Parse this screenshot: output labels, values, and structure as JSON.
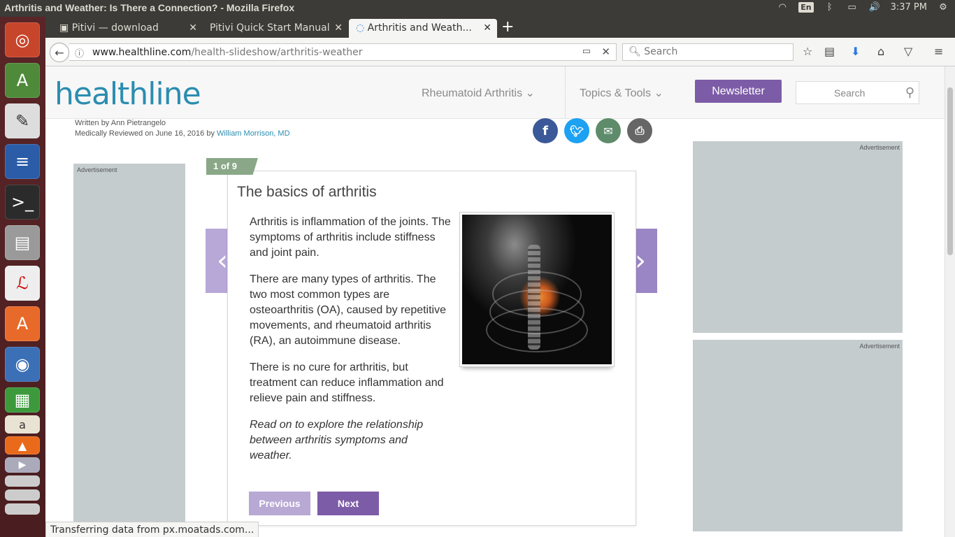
{
  "window": {
    "title": "Arthritis and Weather: Is There a Connection? - Mozilla Firefox"
  },
  "tray": {
    "lang": "En",
    "time": "3:37 PM"
  },
  "tabs": [
    {
      "label": "Pitivi — download"
    },
    {
      "label": "Pitivi Quick Start Manual"
    },
    {
      "label": "Arthritis and Weath..."
    }
  ],
  "nav": {
    "url_domain": "www.healthline.com",
    "url_path": "/health-slideshow/arthritis-weather",
    "search_placeholder": "Search"
  },
  "site": {
    "logo": "healthline",
    "nav_rheumatoid": "Rheumatoid Arthritis",
    "nav_topics": "Topics & Tools",
    "newsletter": "Newsletter",
    "search_placeholder": "Search"
  },
  "byline": {
    "written": "Written by Ann Pietrangelo",
    "reviewed_prefix": "Medically Reviewed on June 16, 2016 by",
    "reviewer": "William Morrison, MD"
  },
  "ads": {
    "label": "Advertisement"
  },
  "slide": {
    "counter": "1 of 9",
    "title": "The basics of arthritis",
    "paragraphs": [
      "Arthritis is inflammation of the joints. The symptoms of arthritis include stiffness and joint pain.",
      "There are many types of arthritis. The two most common types are osteoarthritis (OA), caused by repetitive movements, and rheumatoid arthritis (RA), an autoimmune disease.",
      "There is no cure for arthritis, but treatment can reduce inflammation and relieve pain and stiffness."
    ],
    "closing": "Read on to explore the relationship between arthritis symptoms and weather.",
    "prev": "Previous",
    "next": "Next"
  },
  "status": "Transferring data from px.moatads.com...",
  "colors": {
    "brand": "#2b8db0",
    "purple": "#7d5ca7",
    "counter_green": "#8aa888"
  }
}
